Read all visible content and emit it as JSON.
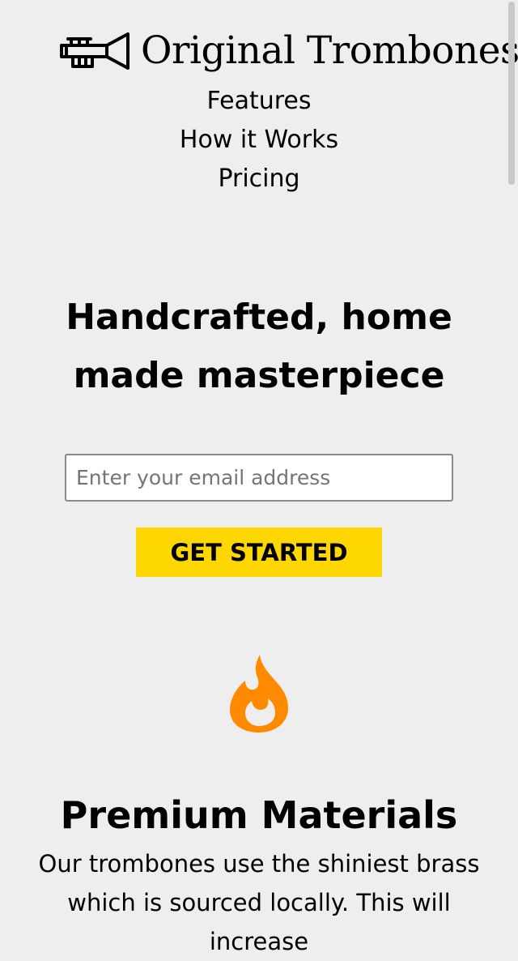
{
  "header": {
    "logo_text": "Original Trombones",
    "logo_icon": "trumpet-icon",
    "nav": [
      "Features",
      "How it Works",
      "Pricing"
    ]
  },
  "hero": {
    "title": "Handcrafted, home made masterpiece",
    "email_placeholder": "Enter your email address",
    "cta_label": "GET STARTED"
  },
  "feature": {
    "icon": "fire-icon",
    "title": "Premium Materials",
    "description": "Our trombones use the shiniest brass which is sourced locally. This will increase"
  },
  "colors": {
    "background": "#eeeeee",
    "cta": "#ffd700",
    "icon_accent": "#ff8a00"
  }
}
